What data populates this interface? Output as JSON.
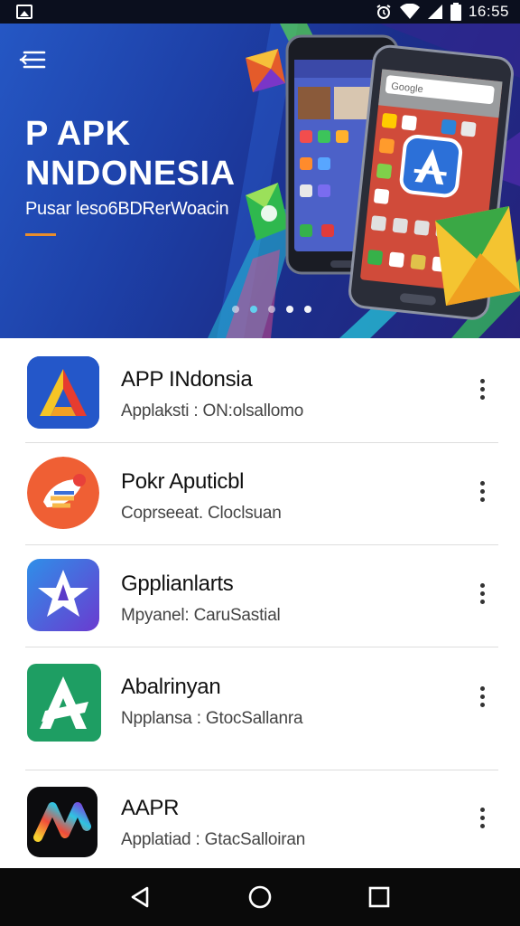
{
  "status_bar": {
    "time": "16:55",
    "icons": [
      "image-icon",
      "alarm-icon",
      "wifi-icon",
      "signal-icon",
      "battery-icon"
    ]
  },
  "hero": {
    "title_line1": "P APK",
    "title_line2": "NNDONESIA",
    "subtitle": "Pusar leso6BDRerWoacin",
    "carousel_dots": 5,
    "active_dot": 2,
    "phone_search_label": "Google",
    "colors": {
      "bg_start": "#2557c4",
      "bg_end": "#26217a",
      "accent": "#e98d2c",
      "dot_active": "#61d6f2"
    }
  },
  "apps": [
    {
      "name": "APP INdonsia",
      "desc": "Applaksti : ON:olsallomo",
      "icon": "triangle-logo-icon"
    },
    {
      "name": "Pokr Aputicbl",
      "desc": "Coprseeat. Cloclsuan",
      "icon": "brush-logo-icon"
    },
    {
      "name": "Gpplianlarts",
      "desc": "Mpyanel: CaruSastial",
      "icon": "star-logo-icon"
    },
    {
      "name": "Abalrinyan",
      "desc": "Npplansa : GtocSallanra",
      "icon": "green-a-logo-icon"
    },
    {
      "name": "AAPR",
      "desc": "Applatiad : GtacSalloiran",
      "icon": "ap-gradient-logo-icon"
    }
  ],
  "nav": {
    "icons": [
      "back-icon",
      "home-icon",
      "recents-icon"
    ]
  }
}
